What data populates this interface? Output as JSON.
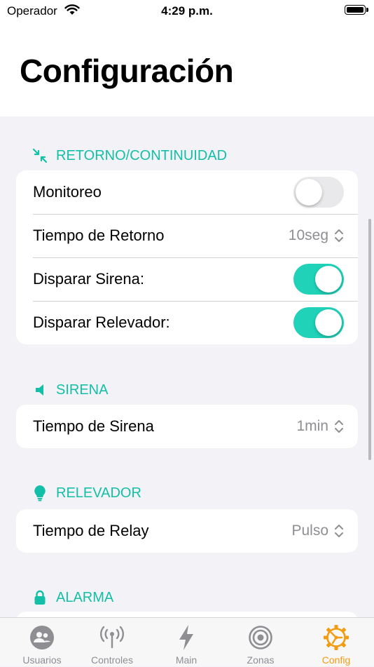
{
  "status_bar": {
    "carrier": "Operador",
    "time": "4:29 p.m."
  },
  "header": {
    "title": "Configuración"
  },
  "sections": {
    "retorno": {
      "title": "RETORNO/CONTINUIDAD",
      "icon": "arrows-collapse-icon",
      "rows": {
        "monitoreo": {
          "label": "Monitoreo",
          "toggle": false
        },
        "tiempo_retorno": {
          "label": "Tiempo de Retorno",
          "value": "10seg"
        },
        "disparar_sirena": {
          "label": "Disparar Sirena:",
          "toggle": true
        },
        "disparar_relevador": {
          "label": "Disparar Relevador:",
          "toggle": true
        }
      }
    },
    "sirena": {
      "title": "SIRENA",
      "icon": "speaker-icon",
      "rows": {
        "tiempo_sirena": {
          "label": "Tiempo de Sirena",
          "value": "1min"
        }
      }
    },
    "relevador": {
      "title": "RELEVADOR",
      "icon": "lightbulb-icon",
      "rows": {
        "tiempo_relay": {
          "label": "Tiempo de Relay",
          "value": "Pulso"
        }
      }
    },
    "alarma": {
      "title": "ALARMA",
      "icon": "lock-icon"
    }
  },
  "tabbar": {
    "tabs": [
      {
        "label": "Usuarios",
        "icon": "users-icon",
        "active": false
      },
      {
        "label": "Controles",
        "icon": "antenna-icon",
        "active": false
      },
      {
        "label": "Main",
        "icon": "bolt-icon",
        "active": false
      },
      {
        "label": "Zonas",
        "icon": "target-icon",
        "active": false
      },
      {
        "label": "Config",
        "icon": "gear-icon",
        "active": true
      }
    ]
  },
  "colors": {
    "accent": "#13bfa6",
    "toggle_on": "#1fd2b8",
    "tab_active": "#f39c12",
    "tab_inactive": "#8e8e93",
    "background": "#f2f2f7"
  }
}
